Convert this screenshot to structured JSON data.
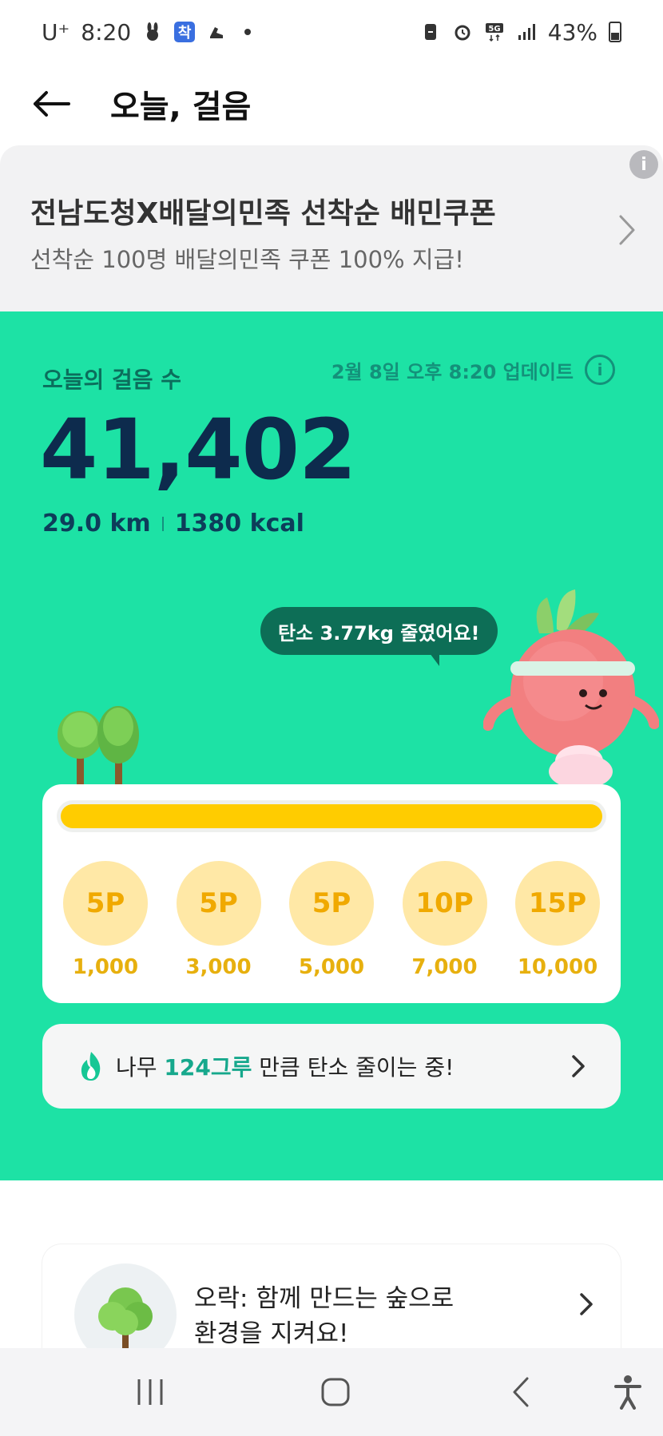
{
  "status_bar": {
    "carrier": "U⁺",
    "time": "8:20",
    "app_badge": "착",
    "battery": "43%"
  },
  "header": {
    "title": "오늘, 걸음"
  },
  "banner": {
    "title": "전남도청X배달의민족 선착순 배민쿠폰",
    "subtitle": "선착순 100명 배달의민족 쿠폰 100% 지급!",
    "info": "i"
  },
  "steps": {
    "label": "오늘의 걸음 수",
    "updated": "2월 8일 오후 8:20 업데이트",
    "info": "i",
    "count": "41,402",
    "distance": "29.0 km",
    "calories": "1380 kcal"
  },
  "carbon_bubble": "탄소 3.77kg 줄였어요!",
  "progress": {
    "fraction": 1.0,
    "milestones": [
      {
        "points": "5P",
        "steps": "1,000"
      },
      {
        "points": "5P",
        "steps": "3,000"
      },
      {
        "points": "5P",
        "steps": "5,000"
      },
      {
        "points": "10P",
        "steps": "7,000"
      },
      {
        "points": "15P",
        "steps": "10,000"
      }
    ]
  },
  "tree_card": {
    "prefix": "나무 ",
    "highlight": "124그루",
    "suffix": " 만큼 탄소 줄이는 중!"
  },
  "bottom_card": {
    "line1": "오락: 함께 만드는 숲으로",
    "line2": "환경을 지켜요!"
  },
  "colors": {
    "accent_green": "#1de2a5",
    "dark_green": "#0d6e56",
    "progress_fill": "#ffcc00",
    "milestone_bg": "#ffe8a6"
  }
}
